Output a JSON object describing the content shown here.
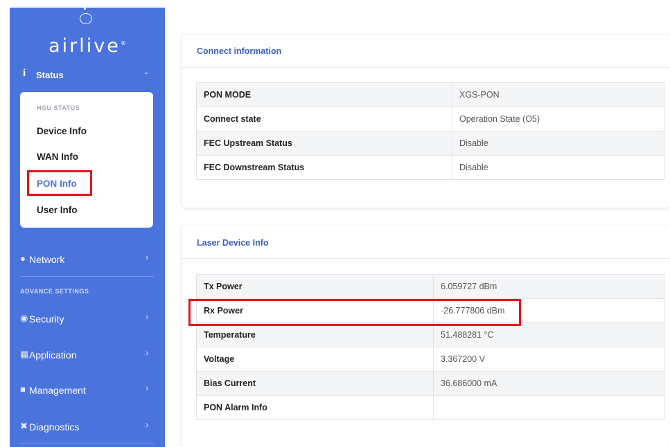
{
  "logo": {
    "text": "airlive",
    "mark": "®"
  },
  "sidebar": {
    "status": {
      "label": "Status",
      "icon": "info-icon"
    },
    "submenu": {
      "section": "HGU STATUS",
      "items": [
        {
          "label": "Device Info"
        },
        {
          "label": "WAN Info"
        },
        {
          "label": "PON Info",
          "active": true
        },
        {
          "label": "User Info"
        }
      ]
    },
    "network": {
      "label": "Network"
    },
    "advance_section": "ADVANCE SETTINGS",
    "nav": [
      {
        "label": "Security",
        "icon": "shield-icon"
      },
      {
        "label": "Application",
        "icon": "sitemap-icon"
      },
      {
        "label": "Management",
        "icon": "management-icon"
      },
      {
        "label": "Diagnostics",
        "icon": "tools-icon"
      }
    ]
  },
  "connect": {
    "title": "Connect information",
    "rows": [
      {
        "key": "PON MODE",
        "value": "XGS-PON"
      },
      {
        "key": "Connect state",
        "value": "Operation State (O5)"
      },
      {
        "key": "FEC Upstream Status",
        "value": "Disable"
      },
      {
        "key": "FEC Downstream Status",
        "value": "Disable"
      }
    ]
  },
  "laser": {
    "title": "Laser Device Info",
    "rows": [
      {
        "key": "Tx Power",
        "value": "6.059727 dBm"
      },
      {
        "key": "Rx Power",
        "value": "-26.777806 dBm"
      },
      {
        "key": "Temperature",
        "value": "51.488281 °C"
      },
      {
        "key": "Voltage",
        "value": "3.367200 V"
      },
      {
        "key": "Bias Current",
        "value": "36.686000 mA"
      },
      {
        "key": "PON Alarm Info",
        "value": ""
      }
    ]
  },
  "colors": {
    "sidebar": "#4b73dc",
    "accent": "#3d5fc4",
    "highlight": "#e8141b"
  }
}
